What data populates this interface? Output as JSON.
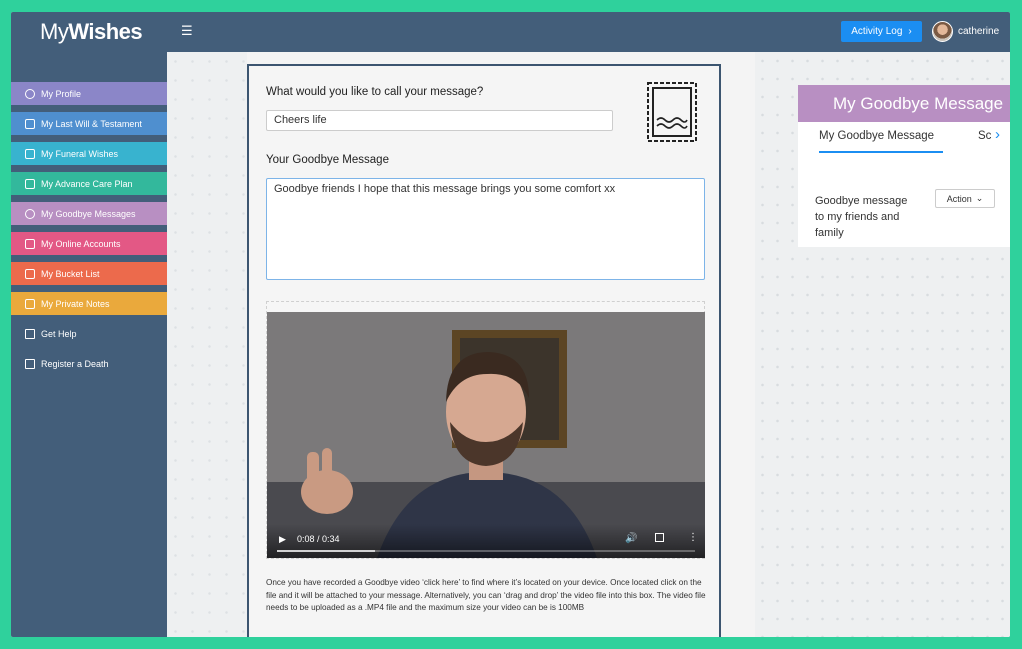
{
  "app": {
    "logo_prefix": "My",
    "logo_bold": "Wishes"
  },
  "header": {
    "menu_icon": "hamburger-icon",
    "activity_log_label": "Activity Log",
    "activity_log_icon": "chevron-right-icon",
    "username": "catherine"
  },
  "sidebar": {
    "items": [
      {
        "label": "My Profile",
        "icon": "profile-icon",
        "color": "#8b86c8"
      },
      {
        "label": "My Last Will & Testament",
        "icon": "document-icon",
        "color": "#4f8fcf"
      },
      {
        "label": "My Funeral Wishes",
        "icon": "calendar-icon",
        "color": "#38b3cf"
      },
      {
        "label": "My Advance Care Plan",
        "icon": "book-icon",
        "color": "#33b89c"
      },
      {
        "label": "My Goodbye Messages",
        "icon": "fingerprint-icon",
        "color": "#b88fc2"
      },
      {
        "label": "My Online Accounts",
        "icon": "accounts-icon",
        "color": "#e35885"
      },
      {
        "label": "My Bucket List",
        "icon": "bucket-icon",
        "color": "#ec6a4c"
      },
      {
        "label": "My Private Notes",
        "icon": "notes-icon",
        "color": "#eaa93c"
      },
      {
        "label": "Get Help",
        "icon": "edit-icon"
      },
      {
        "label": "Register a Death",
        "icon": "register-icon"
      }
    ]
  },
  "form": {
    "title_question": "What would you like to call your message?",
    "title_value": "Cheers life",
    "message_label": "Your Goodbye Message",
    "message_value": "Goodbye friends I hope that this message brings you some comfort xx",
    "stamp_icon": "stamp-icon",
    "video": {
      "time": "0:08 / 0:34",
      "progress": 0.235,
      "play_icon": "play-icon",
      "volume_icon": "volume-icon",
      "fullscreen_icon": "fullscreen-icon",
      "more_icon": "more-vertical-icon"
    },
    "help_text": "Once you have recorded a Goodbye video ‘click here’ to find where it’s located on your device. Once located click on the file and it will be attached to your message. Alternatively, you can ‘drag and drop’ the video file into this box. The video file needs to be uploaded as a .MP4 file and the maximum size your video can be is 100MB"
  },
  "right_panel": {
    "header": "My Goodbye Message",
    "tab_active": "My Goodbye Message",
    "tab_next": "Sc",
    "message_title": "Goodbye message to my friends and family",
    "action_label": "Action",
    "header_color": "#b88fc2",
    "accent_color": "#1b8ef2"
  }
}
